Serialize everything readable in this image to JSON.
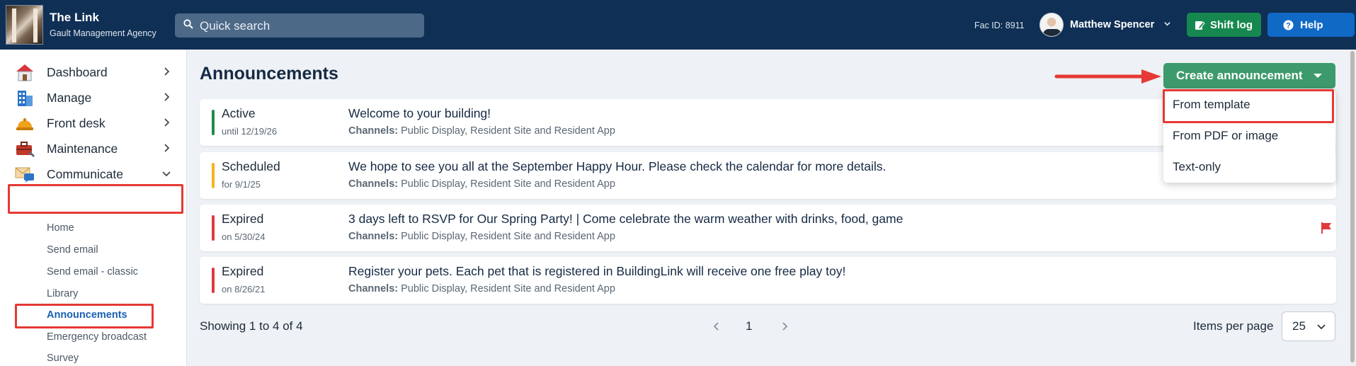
{
  "header": {
    "brand_title": "The Link",
    "brand_subtitle": "Gault Management Agency",
    "search_placeholder": "Quick search",
    "fac_id": "Fac ID: 8911",
    "user_name": "Matthew Spencer",
    "shift_log_label": "Shift log",
    "help_label": "Help"
  },
  "sidebar": {
    "items": [
      {
        "label": "Dashboard",
        "icon": "house-icon"
      },
      {
        "label": "Manage",
        "icon": "buildings-icon"
      },
      {
        "label": "Front desk",
        "icon": "bell-icon"
      },
      {
        "label": "Maintenance",
        "icon": "toolbox-icon"
      },
      {
        "label": "Communicate",
        "icon": "mail-chat-icon"
      }
    ],
    "sub_items": [
      "Home",
      "Send email",
      "Send email - classic",
      "Library",
      "Announcements",
      "Emergency broadcast",
      "Survey"
    ]
  },
  "main": {
    "title": "Announcements",
    "create_button": "Create announcement",
    "dropdown": [
      "From template",
      "From PDF or image",
      "Text-only"
    ],
    "announcements": [
      {
        "status": "Active",
        "date": "until 12/19/26",
        "title": "Welcome to your building!",
        "channels_label": "Channels:",
        "channels": "Public Display, Resident Site and Resident App",
        "color": "#1f8a4c"
      },
      {
        "status": "Scheduled",
        "date": "for 9/1/25",
        "title": "We hope to see you all at the September Happy Hour. Please check the calendar for more details.",
        "channels_label": "Channels:",
        "channels": "Public Display, Resident Site and Resident App",
        "color": "#f2b61d"
      },
      {
        "status": "Expired",
        "date": "on 5/30/24",
        "title": "3 days left to RSVP for Our Spring Party! | Come celebrate the warm weather with drinks, food, game",
        "channels_label": "Channels:",
        "channels": "Public Display, Resident Site and Resident App",
        "color": "#e0393e"
      },
      {
        "status": "Expired",
        "date": "on 8/26/21",
        "title": "Register your pets. Each pet that is registered in BuildingLink will receive one free play toy!",
        "channels_label": "Channels:",
        "channels": "Public Display, Resident Site and Resident App",
        "color": "#e0393e"
      }
    ],
    "showing": "Showing 1 to 4 of 4",
    "page": "1",
    "items_per_page_label": "Items per page",
    "items_per_page": "25"
  }
}
